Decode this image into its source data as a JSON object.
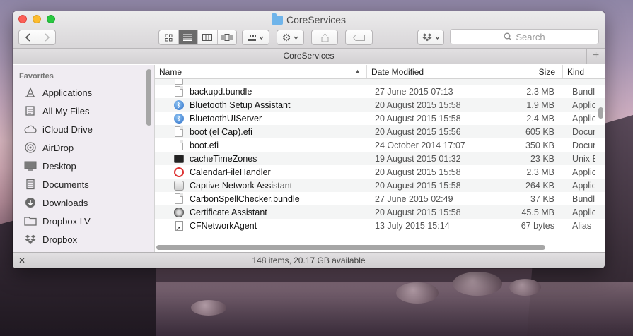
{
  "window": {
    "title": "CoreServices",
    "path_title": "CoreServices",
    "status": "148 items, 20.17 GB available"
  },
  "toolbar": {
    "search_placeholder": "Search",
    "view_modes": [
      "icon",
      "list",
      "column",
      "cover-flow"
    ],
    "active_view": "list"
  },
  "sidebar": {
    "header": "Favorites",
    "items": [
      {
        "label": "Applications",
        "icon": "applications-icon"
      },
      {
        "label": "All My Files",
        "icon": "all-files-icon"
      },
      {
        "label": "iCloud Drive",
        "icon": "cloud-icon"
      },
      {
        "label": "AirDrop",
        "icon": "airdrop-icon"
      },
      {
        "label": "Desktop",
        "icon": "desktop-icon"
      },
      {
        "label": "Documents",
        "icon": "documents-icon"
      },
      {
        "label": "Downloads",
        "icon": "downloads-icon"
      },
      {
        "label": "Dropbox LV",
        "icon": "folder-icon"
      },
      {
        "label": "Dropbox",
        "icon": "dropbox-icon"
      }
    ]
  },
  "columns": {
    "name": "Name",
    "date": "Date Modified",
    "size": "Size",
    "kind": "Kind"
  },
  "files": [
    {
      "name": "backupd.bundle",
      "date": "27 June 2015 07:13",
      "size": "2.3 MB",
      "kind": "Bundle",
      "icon": "doc"
    },
    {
      "name": "Bluetooth Setup Assistant",
      "date": "20 August 2015 15:58",
      "size": "1.9 MB",
      "kind": "Application",
      "icon": "bt"
    },
    {
      "name": "BluetoothUIServer",
      "date": "20 August 2015 15:58",
      "size": "2.4 MB",
      "kind": "Application",
      "icon": "bt"
    },
    {
      "name": "boot (el Cap).efi",
      "date": "20 August 2015 15:56",
      "size": "605 KB",
      "kind": "Document",
      "icon": "doc"
    },
    {
      "name": "boot.efi",
      "date": "24 October 2014 17:07",
      "size": "350 KB",
      "kind": "Document",
      "icon": "doc"
    },
    {
      "name": "cacheTimeZones",
      "date": "19 August 2015 01:32",
      "size": "23 KB",
      "kind": "Unix Executable",
      "icon": "term"
    },
    {
      "name": "CalendarFileHandler",
      "date": "20 August 2015 15:58",
      "size": "2.3 MB",
      "kind": "Application",
      "icon": "cal"
    },
    {
      "name": "Captive Network Assistant",
      "date": "20 August 2015 15:58",
      "size": "264 KB",
      "kind": "Application",
      "icon": "app"
    },
    {
      "name": "CarbonSpellChecker.bundle",
      "date": "27 June 2015 02:49",
      "size": "37 KB",
      "kind": "Bundle",
      "icon": "doc"
    },
    {
      "name": "Certificate Assistant",
      "date": "20 August 2015 15:58",
      "size": "45.5 MB",
      "kind": "Application",
      "icon": "cert"
    },
    {
      "name": "CFNetworkAgent",
      "date": "13 July 2015 15:14",
      "size": "67 bytes",
      "kind": "Alias",
      "icon": "alias"
    }
  ]
}
